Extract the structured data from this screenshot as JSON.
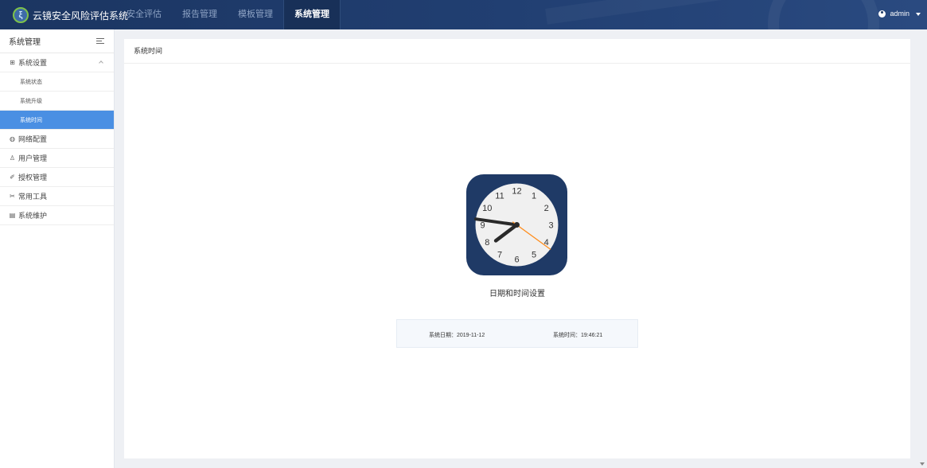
{
  "header": {
    "logo_glyph": "ξ",
    "app_title": "云镜安全风险评估系统",
    "nav": [
      {
        "label": "安全评估"
      },
      {
        "label": "报告管理"
      },
      {
        "label": "模板管理"
      },
      {
        "label": "系统管理"
      }
    ],
    "active_nav": "系统管理",
    "user": "admin"
  },
  "sidebar": {
    "title": "系统管理",
    "groups": [
      {
        "label": "系统设置",
        "icon": "grid-icon",
        "expanded": true,
        "items": [
          {
            "label": "系统状态"
          },
          {
            "label": "系统升级"
          },
          {
            "label": "系统时间"
          }
        ]
      },
      {
        "label": "网络配置",
        "icon": "globe-icon"
      },
      {
        "label": "用户管理",
        "icon": "user-icon"
      },
      {
        "label": "授权管理",
        "icon": "pen-icon"
      },
      {
        "label": "常用工具",
        "icon": "tools-icon"
      },
      {
        "label": "系统维护",
        "icon": "monitor-icon"
      }
    ],
    "active_item": "系统时间"
  },
  "main": {
    "header": "系统时间",
    "clock": {
      "numerals": [
        "12",
        "1",
        "2",
        "3",
        "4",
        "5",
        "6",
        "7",
        "8",
        "9",
        "10",
        "11"
      ],
      "time": "19:46:21",
      "colors": {
        "frame": "#1f3a66",
        "face": "#f0f0f0",
        "hands": "#2a2a2a",
        "second_hand": "#ff8c1a"
      }
    },
    "caption": "日期和时间设置",
    "date_text": "系统日期：2019-11-12",
    "time_text": "系统时间：19:46:21"
  }
}
